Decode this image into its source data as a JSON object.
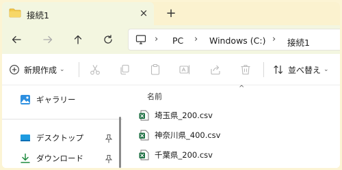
{
  "tab": {
    "title": "接続1",
    "close_icon": "×",
    "new_tab_icon": "+"
  },
  "address": {
    "crumbs": [
      "PC",
      "Windows (C:)",
      "接続1"
    ]
  },
  "commands": {
    "new_label": "新規作成",
    "sort_label": "並べ替え"
  },
  "nav": {
    "items": [
      {
        "label": "ギャラリー",
        "icon": "gallery-icon"
      },
      {
        "label": "デスクトップ",
        "icon": "desktop-icon",
        "pinned": true
      },
      {
        "label": "ダウンロード",
        "icon": "download-icon",
        "pinned": true
      }
    ]
  },
  "files": {
    "column_name": "名前",
    "items": [
      {
        "name": "埼玉県_200.csv",
        "icon": "excel-csv-icon"
      },
      {
        "name": "神奈川県_400.csv",
        "icon": "excel-csv-icon"
      },
      {
        "name": "千葉県_200.csv",
        "icon": "excel-csv-icon"
      }
    ]
  },
  "colors": {
    "titlebar": "#fbf2cf",
    "toolbar": "#f3f6e0",
    "folder": "#f2c94c",
    "accent": "#0067c0",
    "excel_green": "#1d6f42"
  }
}
